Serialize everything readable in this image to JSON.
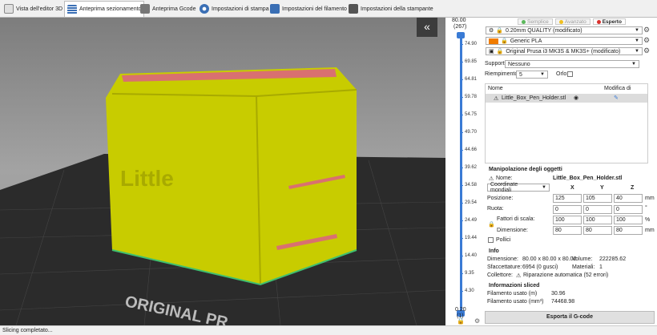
{
  "tabs": [
    {
      "label": "Vista dell'editor 3D",
      "icon": "cube-icon"
    },
    {
      "label": "Anteprima sezionamento",
      "icon": "layers-icon"
    },
    {
      "label": "Anteprima Gcode",
      "icon": "printer-icon"
    },
    {
      "label": "Impostazioni di stampa",
      "icon": "gear-icon"
    },
    {
      "label": "Impostazioni del filamento",
      "icon": "spool-icon"
    },
    {
      "label": "Impostazioni della stampante",
      "icon": "printer-settings-icon"
    }
  ],
  "viewport": {
    "bed_text": "ORIGINAL PR",
    "collapse_glyph": "«"
  },
  "slider": {
    "top_value": "80.00",
    "top_layer": "(267)",
    "bottom_value": "0.20",
    "bottom_layer": "(1)",
    "ticks": [
      "74.90",
      "69.85",
      "64.81",
      "59.78",
      "54.75",
      "49.70",
      "44.66",
      "39.62",
      "34.58",
      "29.54",
      "24.49",
      "19.44",
      "14.40",
      "9.35",
      "4.30"
    ]
  },
  "modes": [
    {
      "label": "Semplice",
      "color": "#5cb85c"
    },
    {
      "label": "Avanzato",
      "color": "#f0c020"
    },
    {
      "label": "Esperto",
      "color": "#d9302c"
    }
  ],
  "presets": {
    "print": "0.20mm QUALITY (modificato)",
    "filament": "Generic PLA",
    "filament_color": "#f07c00",
    "printer": "Original Prusa i3 MK3S & MK3S+ (modificato)"
  },
  "supports": {
    "label": "Supporti:",
    "value": "Nessuno"
  },
  "infill": {
    "label": "Riempimento:",
    "value": "5"
  },
  "brim": {
    "label": "Orlo:"
  },
  "object_list": {
    "col_name": "Nome",
    "col_edit": "Modifica di",
    "items": [
      {
        "name": "Little_Box_Pen_Holder.stl"
      }
    ]
  },
  "manipulation": {
    "title": "Manipolazione degli oggetti",
    "name_label": "Nome:",
    "name_value": "Little_Box_Pen_Holder.stl",
    "coord_system": "Coordinate mondiali",
    "axes": [
      "X",
      "Y",
      "Z"
    ],
    "position_label": "Posizione:",
    "position": [
      "125",
      "105",
      "40"
    ],
    "position_unit": "mm",
    "rotation_label": "Ruota:",
    "rotation": [
      "0",
      "0",
      "0"
    ],
    "rotation_unit": "°",
    "scale_label": "Fattori di scala:",
    "scale": [
      "100",
      "100",
      "100"
    ],
    "scale_unit": "%",
    "size_label": "Dimensione:",
    "size": [
      "80",
      "80",
      "80"
    ],
    "size_unit": "mm",
    "inches_label": "Pollici"
  },
  "info": {
    "title": "Info",
    "size_label": "Dimensione:",
    "size_value": "80.00 x 80.00 x 80.00",
    "volume_label": "Volume:",
    "volume_value": "222285.62",
    "facets_label": "Sfaccettature:",
    "facets_value": "6954 (0 gusci)",
    "materials_label": "Materiali:",
    "materials_value": "1",
    "manifold_label": "Collettore:",
    "manifold_value": "Riparazione automatica (52 errori)"
  },
  "sliced": {
    "title": "Informazioni sliced",
    "filament_m_label": "Filamento usato (m)",
    "filament_m_value": "30.96",
    "filament_mm3_label": "Filamento usato (mm³)",
    "filament_mm3_value": "74468.98"
  },
  "export_label": "Esporta il G-code",
  "status_text": "Slicing completato..."
}
